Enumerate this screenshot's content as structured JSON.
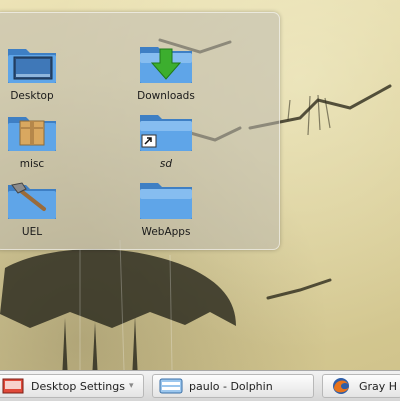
{
  "desktop_folder": {
    "items": [
      {
        "label": "Desktop",
        "icon": "desktop-folder-icon"
      },
      {
        "label": "Downloads",
        "icon": "downloads-folder-icon"
      },
      {
        "label": "misc",
        "icon": "package-folder-icon"
      },
      {
        "label": "sd",
        "icon": "symlink-folder-icon"
      },
      {
        "label": "UEL",
        "icon": "tools-folder-icon"
      },
      {
        "label": "WebApps",
        "icon": "folder-icon"
      }
    ]
  },
  "taskbar": {
    "tasks": [
      {
        "label": "Desktop Settings",
        "icon": "settings-icon"
      },
      {
        "label": "paulo - Dolphin",
        "icon": "dolphin-icon"
      },
      {
        "label": "Gray H",
        "icon": "firefox-icon"
      }
    ]
  },
  "colors": {
    "folder_blue": "#5fa5e8",
    "download_green": "#3cae2e",
    "taskbar_bg": "#e6e6e6"
  }
}
